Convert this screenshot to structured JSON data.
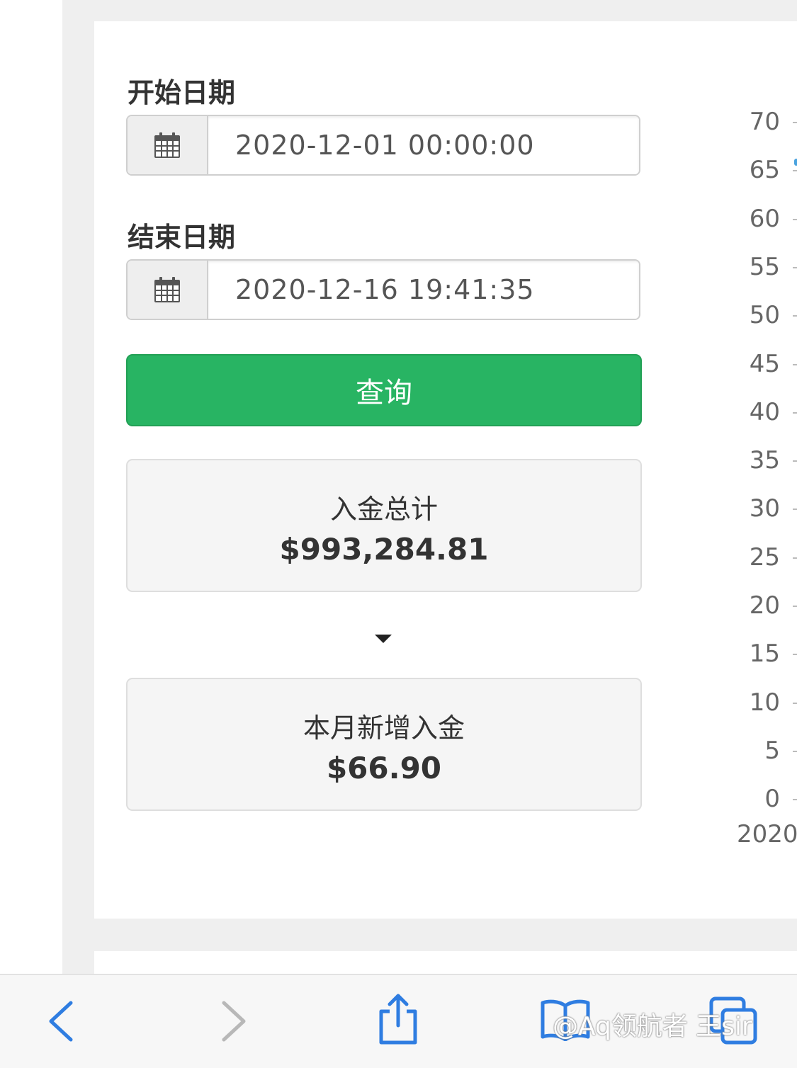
{
  "form": {
    "start_label": "开始日期",
    "start_value": "2020-12-01 00:00:00",
    "end_label": "结束日期",
    "end_value": "2020-12-16 19:41:35",
    "query_button": "查询"
  },
  "stats": {
    "total_title": "入金总计",
    "total_value": "$993,284.81",
    "month_title": "本月新增入金",
    "month_value": "$66.90"
  },
  "chart_data": {
    "type": "line",
    "yticks": [
      "70",
      "65",
      "60",
      "55",
      "50",
      "45",
      "40",
      "35",
      "30",
      "25",
      "20",
      "15",
      "10",
      "5",
      "0"
    ],
    "xtick_visible": "2020-",
    "ylim": [
      0,
      70
    ]
  },
  "toolbar": {
    "icons": [
      "back-icon",
      "forward-icon",
      "share-icon",
      "bookmarks-icon",
      "tabs-icon"
    ]
  },
  "watermark": "@Aq领航者 王sir"
}
